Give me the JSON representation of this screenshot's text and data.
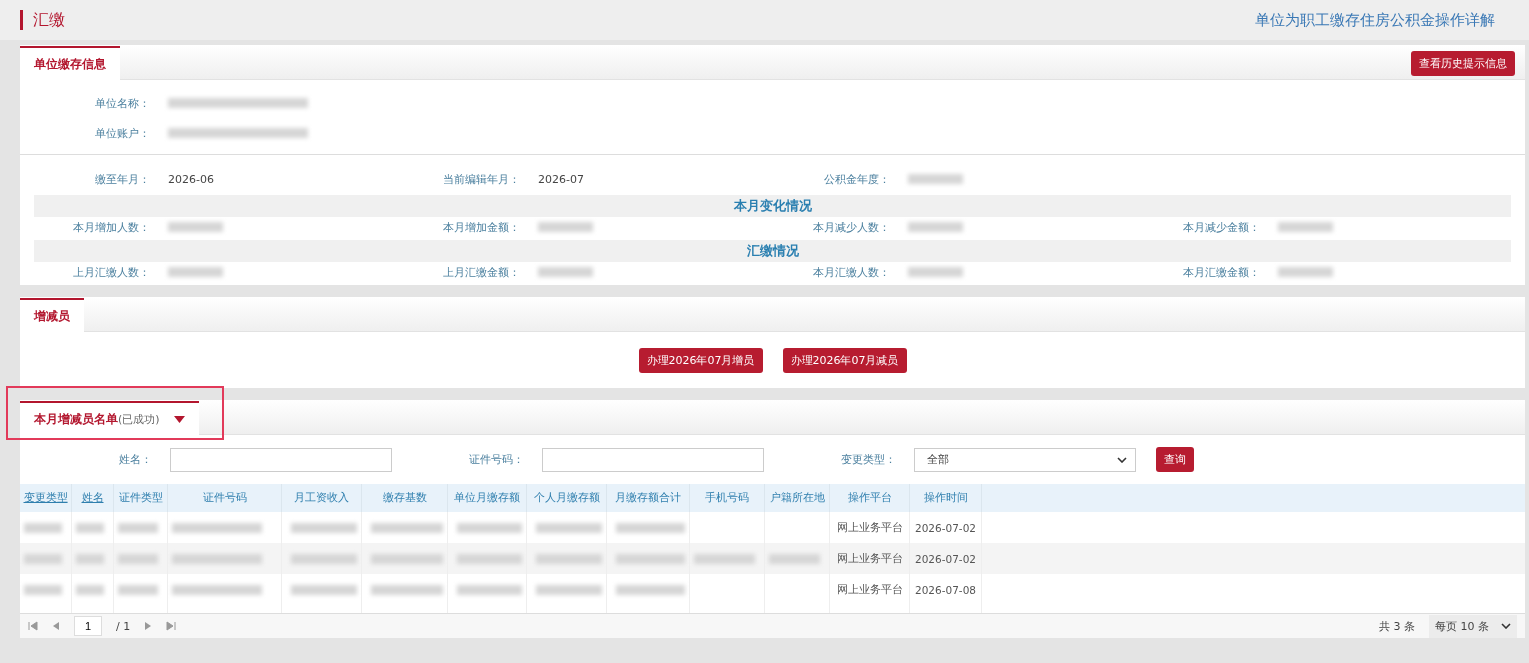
{
  "header": {
    "title": "汇缴",
    "help_link": "单位为职工缴存住房公积金操作详解"
  },
  "unit_panel": {
    "tab": {
      "label": "单位缴存信息",
      "selected": true
    },
    "history_button": "查看历史提示信息",
    "unit_fields": [
      {
        "label": "单位名称：",
        "kind": "blurred"
      },
      {
        "label": "单位账户：",
        "kind": "blurred"
      }
    ],
    "period_fields": [
      {
        "label": "缴至年月：",
        "kind": "text",
        "value": "2026-06"
      },
      {
        "label": "当前编辑年月：",
        "kind": "text",
        "value": "2026-07"
      },
      {
        "label": "公积金年度：",
        "kind": "blurred"
      }
    ],
    "sections": [
      {
        "title": "本月变化情况",
        "fields": [
          {
            "label": "本月增加人数：",
            "kind": "blurred"
          },
          {
            "label": "本月增加金额：",
            "kind": "blurred"
          },
          {
            "label": "本月减少人数：",
            "kind": "blurred"
          },
          {
            "label": "本月减少金额：",
            "kind": "blurred"
          }
        ]
      },
      {
        "title": "汇缴情况",
        "fields": [
          {
            "label": "上月汇缴人数：",
            "kind": "blurred"
          },
          {
            "label": "上月汇缴金额：",
            "kind": "blurred"
          },
          {
            "label": "本月汇缴人数：",
            "kind": "blurred"
          },
          {
            "label": "本月汇缴金额：",
            "kind": "blurred"
          }
        ]
      }
    ]
  },
  "change_panel": {
    "tab": {
      "label": "增减员",
      "selected": true
    },
    "buttons": [
      "办理2026年07月增员",
      "办理2026年07月减员"
    ]
  },
  "list_panel": {
    "tab": {
      "label": "本月增减员名单",
      "note": "(已成功)",
      "selected": true,
      "highlighted": true
    },
    "filters": [
      {
        "label": "姓名：",
        "kind": "input"
      },
      {
        "label": "证件号码：",
        "kind": "input"
      },
      {
        "label": "变更类型：",
        "kind": "select",
        "value": "全部"
      }
    ],
    "query_button": "查询",
    "columns": [
      {
        "label": "变更类型",
        "sortable": true
      },
      {
        "label": "姓名",
        "sortable": true
      },
      {
        "label": "证件类型",
        "sortable": false
      },
      {
        "label": "证件号码",
        "sortable": false
      },
      {
        "label": "月工资收入",
        "sortable": false
      },
      {
        "label": "缴存基数",
        "sortable": false
      },
      {
        "label": "单位月缴存额",
        "sortable": false
      },
      {
        "label": "个人月缴存额",
        "sortable": false
      },
      {
        "label": "月缴存额合计",
        "sortable": false
      },
      {
        "label": "手机号码",
        "sortable": false
      },
      {
        "label": "户籍所在地",
        "sortable": false
      },
      {
        "label": "操作平台",
        "sortable": false
      },
      {
        "label": "操作时间",
        "sortable": false
      }
    ],
    "rows": [
      {
        "cells": [
          {
            "kind": "blurred"
          },
          {
            "kind": "blurred"
          },
          {
            "kind": "blurred"
          },
          {
            "kind": "blurred"
          },
          {
            "kind": "blurred"
          },
          {
            "kind": "blurred"
          },
          {
            "kind": "blurred"
          },
          {
            "kind": "blurred"
          },
          {
            "kind": "blurred"
          },
          {
            "kind": "empty"
          },
          {
            "kind": "empty"
          },
          {
            "kind": "text",
            "text": "网上业务平台"
          },
          {
            "kind": "text",
            "text": "2026-07-02"
          }
        ]
      },
      {
        "cells": [
          {
            "kind": "blurred"
          },
          {
            "kind": "blurred"
          },
          {
            "kind": "blurred"
          },
          {
            "kind": "blurred"
          },
          {
            "kind": "blurred"
          },
          {
            "kind": "blurred"
          },
          {
            "kind": "blurred"
          },
          {
            "kind": "blurred"
          },
          {
            "kind": "blurred"
          },
          {
            "kind": "blurred"
          },
          {
            "kind": "blurred"
          },
          {
            "kind": "text",
            "text": "网上业务平台"
          },
          {
            "kind": "text",
            "text": "2026-07-02"
          }
        ]
      },
      {
        "cells": [
          {
            "kind": "blurred"
          },
          {
            "kind": "blurred"
          },
          {
            "kind": "blurred"
          },
          {
            "kind": "blurred"
          },
          {
            "kind": "blurred"
          },
          {
            "kind": "blurred"
          },
          {
            "kind": "blurred"
          },
          {
            "kind": "blurred"
          },
          {
            "kind": "blurred"
          },
          {
            "kind": "empty"
          },
          {
            "kind": "empty"
          },
          {
            "kind": "text",
            "text": "网上业务平台"
          },
          {
            "kind": "text",
            "text": "2026-07-08"
          }
        ]
      }
    ],
    "pager": {
      "page": "1",
      "total_pages": "/ 1",
      "total": "共 3 条",
      "page_size": "每页 10 条"
    }
  }
}
